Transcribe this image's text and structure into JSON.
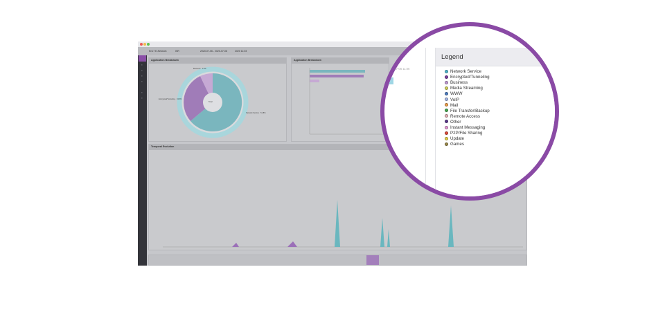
{
  "toolbar": {
    "interface": "En17 E-Network",
    "mode": "ISR",
    "range": "2020-07-06 - 2020-07-06",
    "time": "2020 11:03"
  },
  "panels": {
    "donut_title": "Application Breakdown",
    "bars_title": "Application Breakdown",
    "temporal_title": "Temporal Evolution",
    "donut_center": "Total",
    "donut_label_left": "Encrypted/Tunneling · 43.5%",
    "donut_label_right": "Network Service · 51.8%",
    "donut_label_top": "Business · 3.5%"
  },
  "timestamp": "~ 2020-07-06 11:06",
  "legend": {
    "title": "Legend",
    "items": [
      {
        "label": "Network Service",
        "color": "#4fb8d0"
      },
      {
        "label": "Encrypted/Tunneling",
        "color": "#7b3fa0"
      },
      {
        "label": "Business",
        "color": "#c49bd8"
      },
      {
        "label": "Media Streaming",
        "color": "#d4d35c"
      },
      {
        "label": "WWW",
        "color": "#4f7fc4"
      },
      {
        "label": "VoIP",
        "color": "#a7b8e8"
      },
      {
        "label": "Mail",
        "color": "#f0a04b"
      },
      {
        "label": "File Transfer/Backup",
        "color": "#48a950"
      },
      {
        "label": "Remote Access",
        "color": "#e8b4b8"
      },
      {
        "label": "Other",
        "color": "#5d3b8e"
      },
      {
        "label": "Instant Messaging",
        "color": "#e79ad6"
      },
      {
        "label": "P2P/File Sharing",
        "color": "#e14b3b"
      },
      {
        "label": "Update",
        "color": "#e6d34a"
      },
      {
        "label": "Games",
        "color": "#9c8a4a"
      }
    ]
  },
  "colors": {
    "accent": "#8a4aa5",
    "teal": "#6ab7bf",
    "purple": "#9b6fb8"
  }
}
